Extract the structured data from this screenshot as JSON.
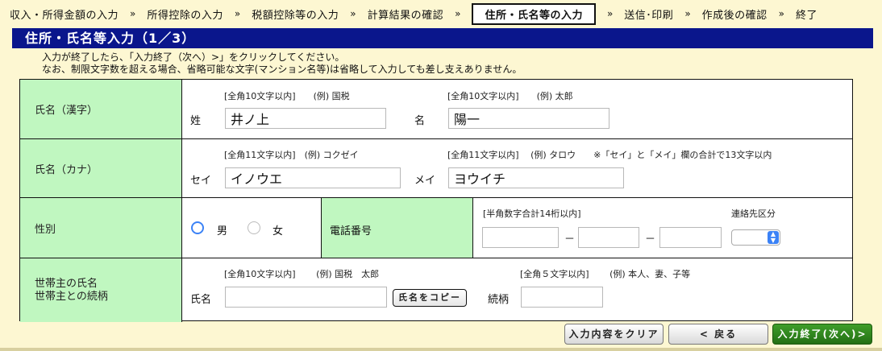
{
  "steps": [
    {
      "label": "収入・所得金額の入力",
      "current": false
    },
    {
      "label": "所得控除の入力",
      "current": false
    },
    {
      "label": "税額控除等の入力",
      "current": false
    },
    {
      "label": "計算結果の確認",
      "current": false
    },
    {
      "label": "住所・氏名等の入力",
      "current": true
    },
    {
      "label": "送信･印刷",
      "current": false
    },
    {
      "label": "作成後の確認",
      "current": false
    },
    {
      "label": "終了",
      "current": false
    }
  ],
  "step_arrow": "»",
  "page_title": "住所・氏名等入力（1／3）",
  "instructions": [
    "入力が終了したら、「入力終了（次へ）>」をクリックしてください。",
    "なお、制限文字数を超える場合、省略可能な文字(マンション名等)は省略して入力しても差し支えありません。"
  ],
  "name_kanji": {
    "label": "氏名（漢字）",
    "sei_hint": "[全角10文字以内]　　(例) 国税",
    "mei_hint": "[全角10文字以内]　　(例) 太郎",
    "sei_label": "姓",
    "mei_label": "名",
    "sei_value": "井ノ上",
    "mei_value": "陽一"
  },
  "name_kana": {
    "label": "氏名（カナ）",
    "sei_hint": "[全角11文字以内]　(例) コクゼイ",
    "mei_hint": "[全角11文字以内]　 (例) タロウ　　※「セイ」と「メイ」欄の合計で13文字以内",
    "sei_label": "セイ",
    "mei_label": "メイ",
    "sei_value": "イノウエ",
    "mei_value": "ヨウイチ"
  },
  "gender": {
    "label": "性別",
    "male": "男",
    "female": "女",
    "selected": "male"
  },
  "phone": {
    "label": "電話番号",
    "hint": "[半角数字合計14桁以内]",
    "dash": "－",
    "part1": "",
    "part2": "",
    "part3": "",
    "contact_label": "連絡先区分",
    "contact_value": ""
  },
  "householder": {
    "label_line1": "世帯主の氏名",
    "label_line2": "世帯主との続柄",
    "name_hint": "[全角10文字以内]　　 (例) 国税　太郎",
    "rel_hint": "[全角５文字以内]　　 (例) 本人、妻、子等",
    "name_label": "氏名",
    "rel_label": "続柄",
    "name_value": "",
    "rel_value": "",
    "copy_button": "氏名をコピー"
  },
  "buttons": {
    "clear": "入力内容をクリア",
    "back": "< 戻る",
    "next": "入力終了(次へ)>"
  },
  "colors": {
    "title_bar": "#0a168c",
    "label_bg": "#c0f7c0",
    "page_bg": "#fdf7d2",
    "next_button": "#2e8a1e"
  }
}
